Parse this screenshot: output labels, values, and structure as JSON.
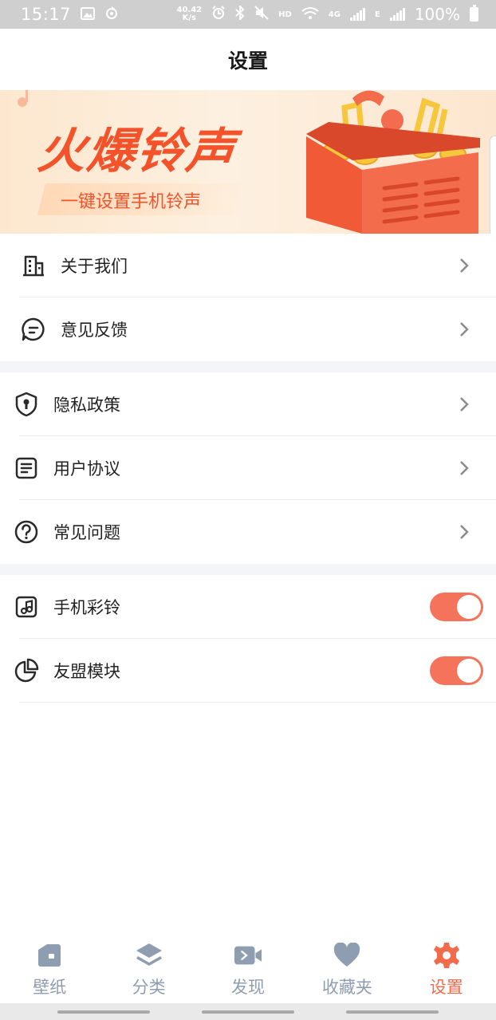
{
  "status_bar": {
    "time": "15:17",
    "net_speed_value": "40.42",
    "net_speed_unit": "K/s",
    "hd_label": "HD",
    "net_4g_label": "4G",
    "net_e_label": "E",
    "battery": "100%"
  },
  "header": {
    "title": "设置"
  },
  "banner": {
    "title": "火爆铃声",
    "subtitle": "一键设置手机铃声"
  },
  "menu_groups": [
    {
      "items": [
        {
          "label": "关于我们",
          "icon": "building-icon"
        },
        {
          "label": "意见反馈",
          "icon": "feedback-icon"
        }
      ]
    },
    {
      "items": [
        {
          "label": "隐私政策",
          "icon": "shield-lock-icon"
        },
        {
          "label": "用户协议",
          "icon": "document-icon"
        },
        {
          "label": "常见问题",
          "icon": "question-icon"
        }
      ]
    },
    {
      "items": [
        {
          "label": "手机彩铃",
          "icon": "music-note-icon",
          "toggle_on": true
        },
        {
          "label": "友盟模块",
          "icon": "pie-chart-icon",
          "toggle_on": true
        }
      ]
    }
  ],
  "bottom_nav": {
    "items": [
      {
        "label": "壁纸",
        "icon": "wallpaper-icon"
      },
      {
        "label": "分类",
        "icon": "layers-icon"
      },
      {
        "label": "发现",
        "icon": "video-icon"
      },
      {
        "label": "收藏夹",
        "icon": "heart-icon"
      },
      {
        "label": "设置",
        "icon": "gear-icon"
      }
    ],
    "active": "设置"
  },
  "colors": {
    "accent": "#f26b4b",
    "toggle_on": "#f5735a",
    "nav_inactive": "#8f9db0",
    "section_gap": "#f4f5f8"
  }
}
